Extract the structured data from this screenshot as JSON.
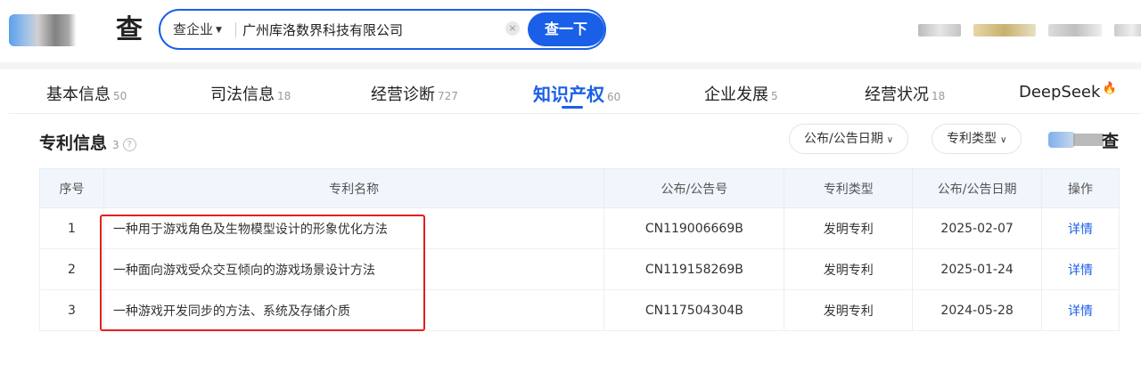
{
  "header": {
    "logo_char": "查",
    "search": {
      "scope": "查企业",
      "value": "广州库洛数界科技有限公司",
      "button": "查一下",
      "clear": "×"
    }
  },
  "tabs": [
    {
      "label": "基本信息",
      "count": "50"
    },
    {
      "label": "司法信息",
      "count": "18"
    },
    {
      "label": "经营诊断",
      "count": "727"
    },
    {
      "label": "知识产权",
      "count": "60"
    },
    {
      "label": "企业发展",
      "count": "5"
    },
    {
      "label": "经营状况",
      "count": "18"
    },
    {
      "label": "DeepSeek",
      "count": ""
    }
  ],
  "section": {
    "title": "专利信息",
    "count": "3",
    "help": "?",
    "filters": {
      "date": "公布/公告日期",
      "type": "专利类型"
    },
    "brand_char": "查"
  },
  "table": {
    "headers": [
      "序号",
      "专利名称",
      "公布/公告号",
      "专利类型",
      "公布/公告日期",
      "操作"
    ],
    "rows": [
      {
        "no": "1",
        "name": "一种用于游戏角色及生物模型设计的形象优化方法",
        "pub": "CN119006669B",
        "type": "发明专利",
        "date": "2025-02-07",
        "action": "详情"
      },
      {
        "no": "2",
        "name": "一种面向游戏受众交互倾向的游戏场景设计方法",
        "pub": "CN119158269B",
        "type": "发明专利",
        "date": "2025-01-24",
        "action": "详情"
      },
      {
        "no": "3",
        "name": "一种游戏开发同步的方法、系统及存储介质",
        "pub": "CN117504304B",
        "type": "发明专利",
        "date": "2024-05-28",
        "action": "详情"
      }
    ]
  },
  "colors": {
    "accent": "#1a5fe8",
    "highlight_box": "#e3201b"
  }
}
